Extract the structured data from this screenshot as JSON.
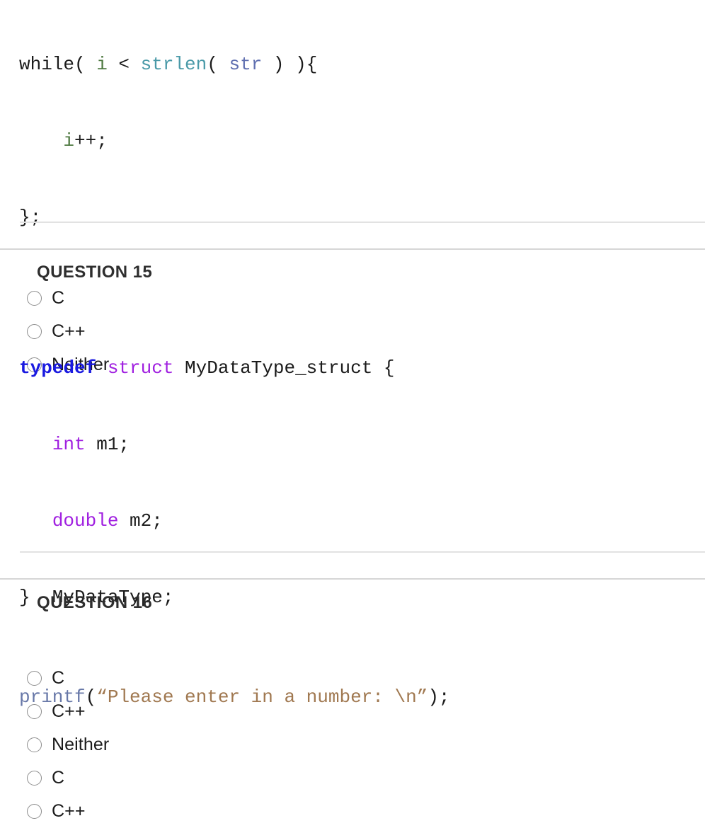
{
  "page": {
    "background": "#ffffff",
    "divider_color": "#d6d6d6"
  },
  "colors": {
    "text": "#1b1b1b",
    "heading": "#2e2e2e",
    "radio_border": "#8e8e8e",
    "kw_typedef_blue": "#1a1ae0",
    "kw_type_purple": "#a020e0",
    "fn_teal": "#4a9aa8",
    "var_slate": "#5f6fb0",
    "var_green": "#4f7a42",
    "fn_slate_blue": "#6878a8",
    "string_tan": "#a07850"
  },
  "questions": [
    {
      "id": "q14-partial",
      "header": null,
      "code_lines": [
        {
          "tokens": [
            {
              "text": "while( ",
              "color": "#1b1b1b"
            },
            {
              "text": "i",
              "color": "#4f7a42"
            },
            {
              "text": " < ",
              "color": "#1b1b1b"
            },
            {
              "text": "strlen",
              "color": "#4a9aa8"
            },
            {
              "text": "( ",
              "color": "#1b1b1b"
            },
            {
              "text": "str",
              "color": "#5f6fb0"
            },
            {
              "text": " ) ){",
              "color": "#1b1b1b"
            }
          ]
        },
        {
          "tokens": [
            {
              "text": "    ",
              "color": "#1b1b1b"
            },
            {
              "text": "i",
              "color": "#4f7a42"
            },
            {
              "text": "++;",
              "color": "#1b1b1b"
            }
          ]
        },
        {
          "tokens": [
            {
              "text": "};",
              "color": "#1b1b1b"
            }
          ]
        }
      ],
      "options": [
        {
          "label": "C",
          "selected": false
        },
        {
          "label": "C++",
          "selected": false
        },
        {
          "label": "Neither",
          "selected": false
        }
      ]
    },
    {
      "id": "q15",
      "header": "QUESTION 15",
      "code_lines": [
        {
          "tokens": [
            {
              "text": "typedef",
              "color": "#1a1ae0",
              "bold": true
            },
            {
              "text": " ",
              "color": "#1b1b1b"
            },
            {
              "text": "struct",
              "color": "#a020e0"
            },
            {
              "text": " MyDataType_struct {",
              "color": "#1b1b1b"
            }
          ]
        },
        {
          "tokens": [
            {
              "text": "   ",
              "color": "#1b1b1b"
            },
            {
              "text": "int",
              "color": "#a020e0"
            },
            {
              "text": " m1;",
              "color": "#1b1b1b"
            }
          ]
        },
        {
          "tokens": [
            {
              "text": "   ",
              "color": "#1b1b1b"
            },
            {
              "text": "double",
              "color": "#a020e0"
            },
            {
              "text": " m2;",
              "color": "#1b1b1b"
            }
          ]
        },
        {
          "tokens": [
            {
              "text": "}  MyDataType;",
              "color": "#1b1b1b"
            }
          ]
        }
      ],
      "options": [
        {
          "label": "C",
          "selected": false
        },
        {
          "label": "C++",
          "selected": false
        },
        {
          "label": "Neither",
          "selected": false
        }
      ]
    },
    {
      "id": "q16",
      "header": "QUESTION 16",
      "code_lines": [
        {
          "tokens": [
            {
              "text": "printf",
              "color": "#6878a8"
            },
            {
              "text": "(",
              "color": "#1b1b1b"
            },
            {
              "text": "“Please enter in a number: \\n”",
              "color": "#a07850"
            },
            {
              "text": ");",
              "color": "#1b1b1b"
            }
          ]
        }
      ],
      "options": [
        {
          "label": "C",
          "selected": false
        },
        {
          "label": "C++",
          "selected": false
        }
      ]
    }
  ]
}
